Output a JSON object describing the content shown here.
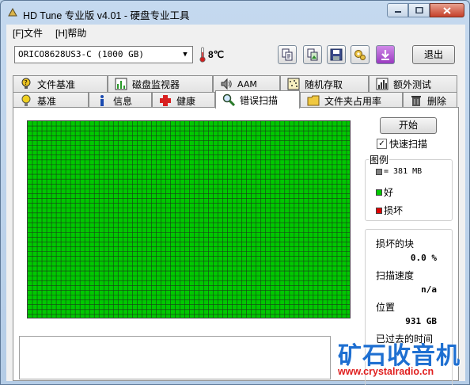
{
  "window": {
    "title": "HD Tune 专业版 v4.01 - 硬盘专业工具"
  },
  "menu": {
    "items": [
      "[F]文件",
      "[H]帮助"
    ]
  },
  "toolbar": {
    "drive": "ORICO8628US3-C (1000 GB)",
    "temperature": "8℃",
    "exit_label": "退出",
    "buttons": [
      "copy-text-icon",
      "copy-screenshot-icon",
      "save-icon",
      "options-icon",
      "download-icon"
    ]
  },
  "tabs": {
    "top": [
      "文件基准",
      "磁盘监视器",
      "AAM",
      "随机存取",
      "额外测试"
    ],
    "bottom": [
      "基准",
      "信息",
      "健康",
      "错误扫描",
      "文件夹占用率",
      "删除"
    ],
    "active": "错误扫描"
  },
  "scan": {
    "start_label": "开始",
    "quick_scan_label": "快速扫描",
    "quick_scan_checked": true,
    "grid": {
      "cols": 68,
      "rows": 41,
      "fill_color": "#00c800",
      "line_color": "#1a3a1a"
    }
  },
  "legend": {
    "title": "图例",
    "block_size": "= 381 MB",
    "good_label": "好",
    "bad_label": "损坏",
    "colors": {
      "block": "#808080",
      "good": "#00c800",
      "bad": "#e00000"
    }
  },
  "stats": {
    "damaged_label": "损坏的块",
    "damaged_value": "0.0 %",
    "speed_label": "扫描速度",
    "speed_value": "n/a",
    "position_label": "位置",
    "position_value": "931 GB",
    "elapsed_label": "已过去的时间"
  },
  "watermark": {
    "text": "矿石收音机",
    "url": "www.crystalradio.cn"
  }
}
